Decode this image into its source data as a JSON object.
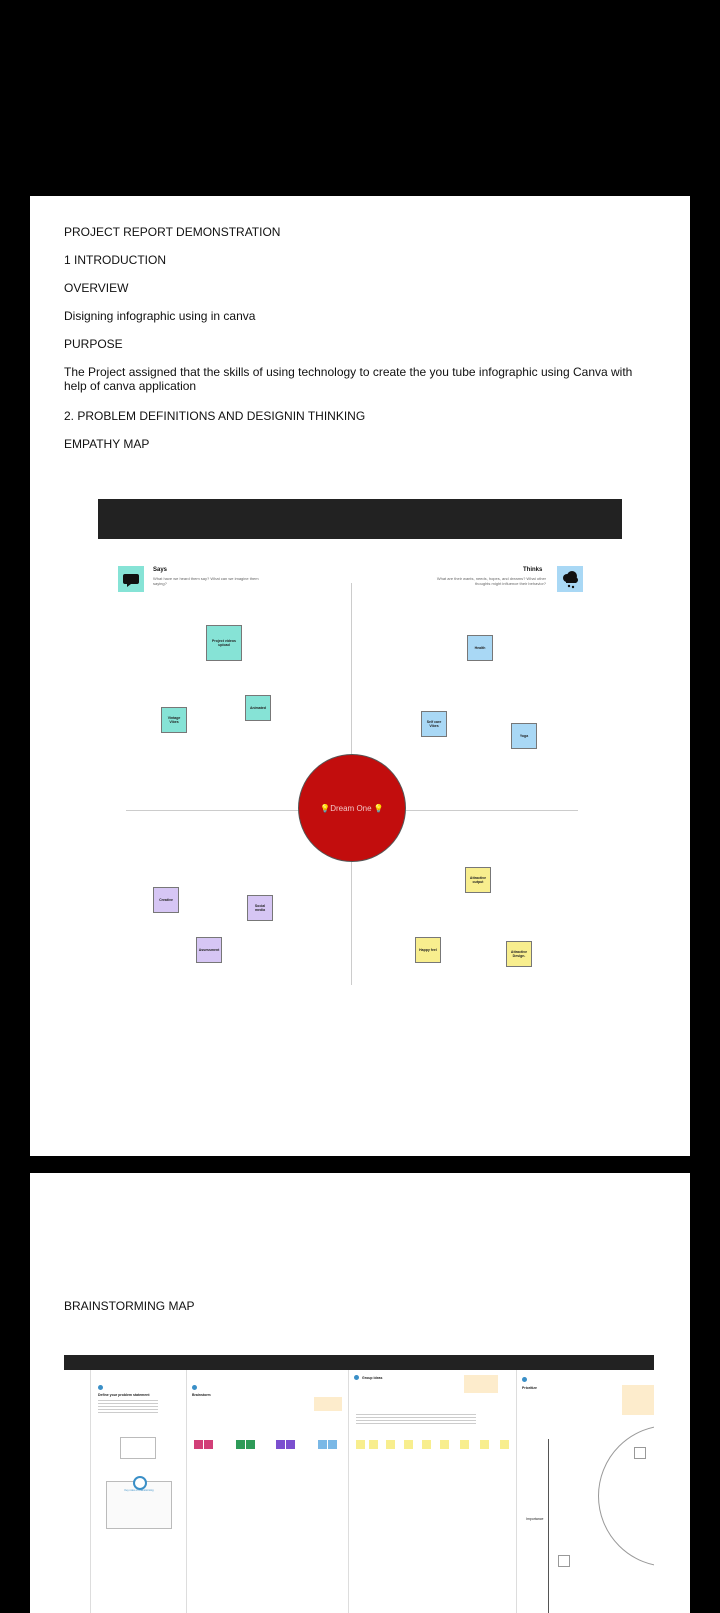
{
  "report": {
    "title": "PROJECT REPORT DEMONSTRATION",
    "intro": "1 INTRODUCTION",
    "overview": "OVERVIEW",
    "overview_text": "Disigning infographic using in canva",
    "purpose": "PURPOSE",
    "purpose_text": "The Project assigned that the skills of using  technology to create the you tube infographic using Canva with help of canva application",
    "problem": "2. PROBLEM DEFINITIONS AND DESIGNIN THINKING",
    "empathy": "EMPATHY MAP",
    "brainstorm": "BRAINSTORMING MAP"
  },
  "empathy_map": {
    "says": {
      "title": "Says",
      "sub": "What have we heard them say? What can we imagine them saying?"
    },
    "thinks": {
      "title": "Thinks",
      "sub": "What are their wants, needs, hopes, and dreams? What other thoughts might influence their behavior?"
    },
    "center": "💡Dream One 💡",
    "notes": {
      "n1": "Project videos upload",
      "n2": "Animated",
      "n3": "Vintage Vibes",
      "n4": "Health",
      "n5": "Self care Vibes",
      "n6": "Yoga",
      "n7": "Creative",
      "n8": "Social media",
      "n9": "Assessment",
      "n10": "Attractive output",
      "n11": "Happy feel",
      "n12": "Attractive Design."
    }
  },
  "brainstorm_map": {
    "c1_title": "Define your problem statement",
    "c2_title": "Brainstorm",
    "c3_title": "Group ideas",
    "c4_title": "Prioritize",
    "c1_card": "Key rules of brainstorming",
    "c4_axis": "Importance"
  },
  "colors": {
    "dream": "#c20d0d",
    "teal": "#86e3d6",
    "blue": "#a9d8f5",
    "purple": "#d6c6f4",
    "yellow": "#f8ee8e"
  }
}
